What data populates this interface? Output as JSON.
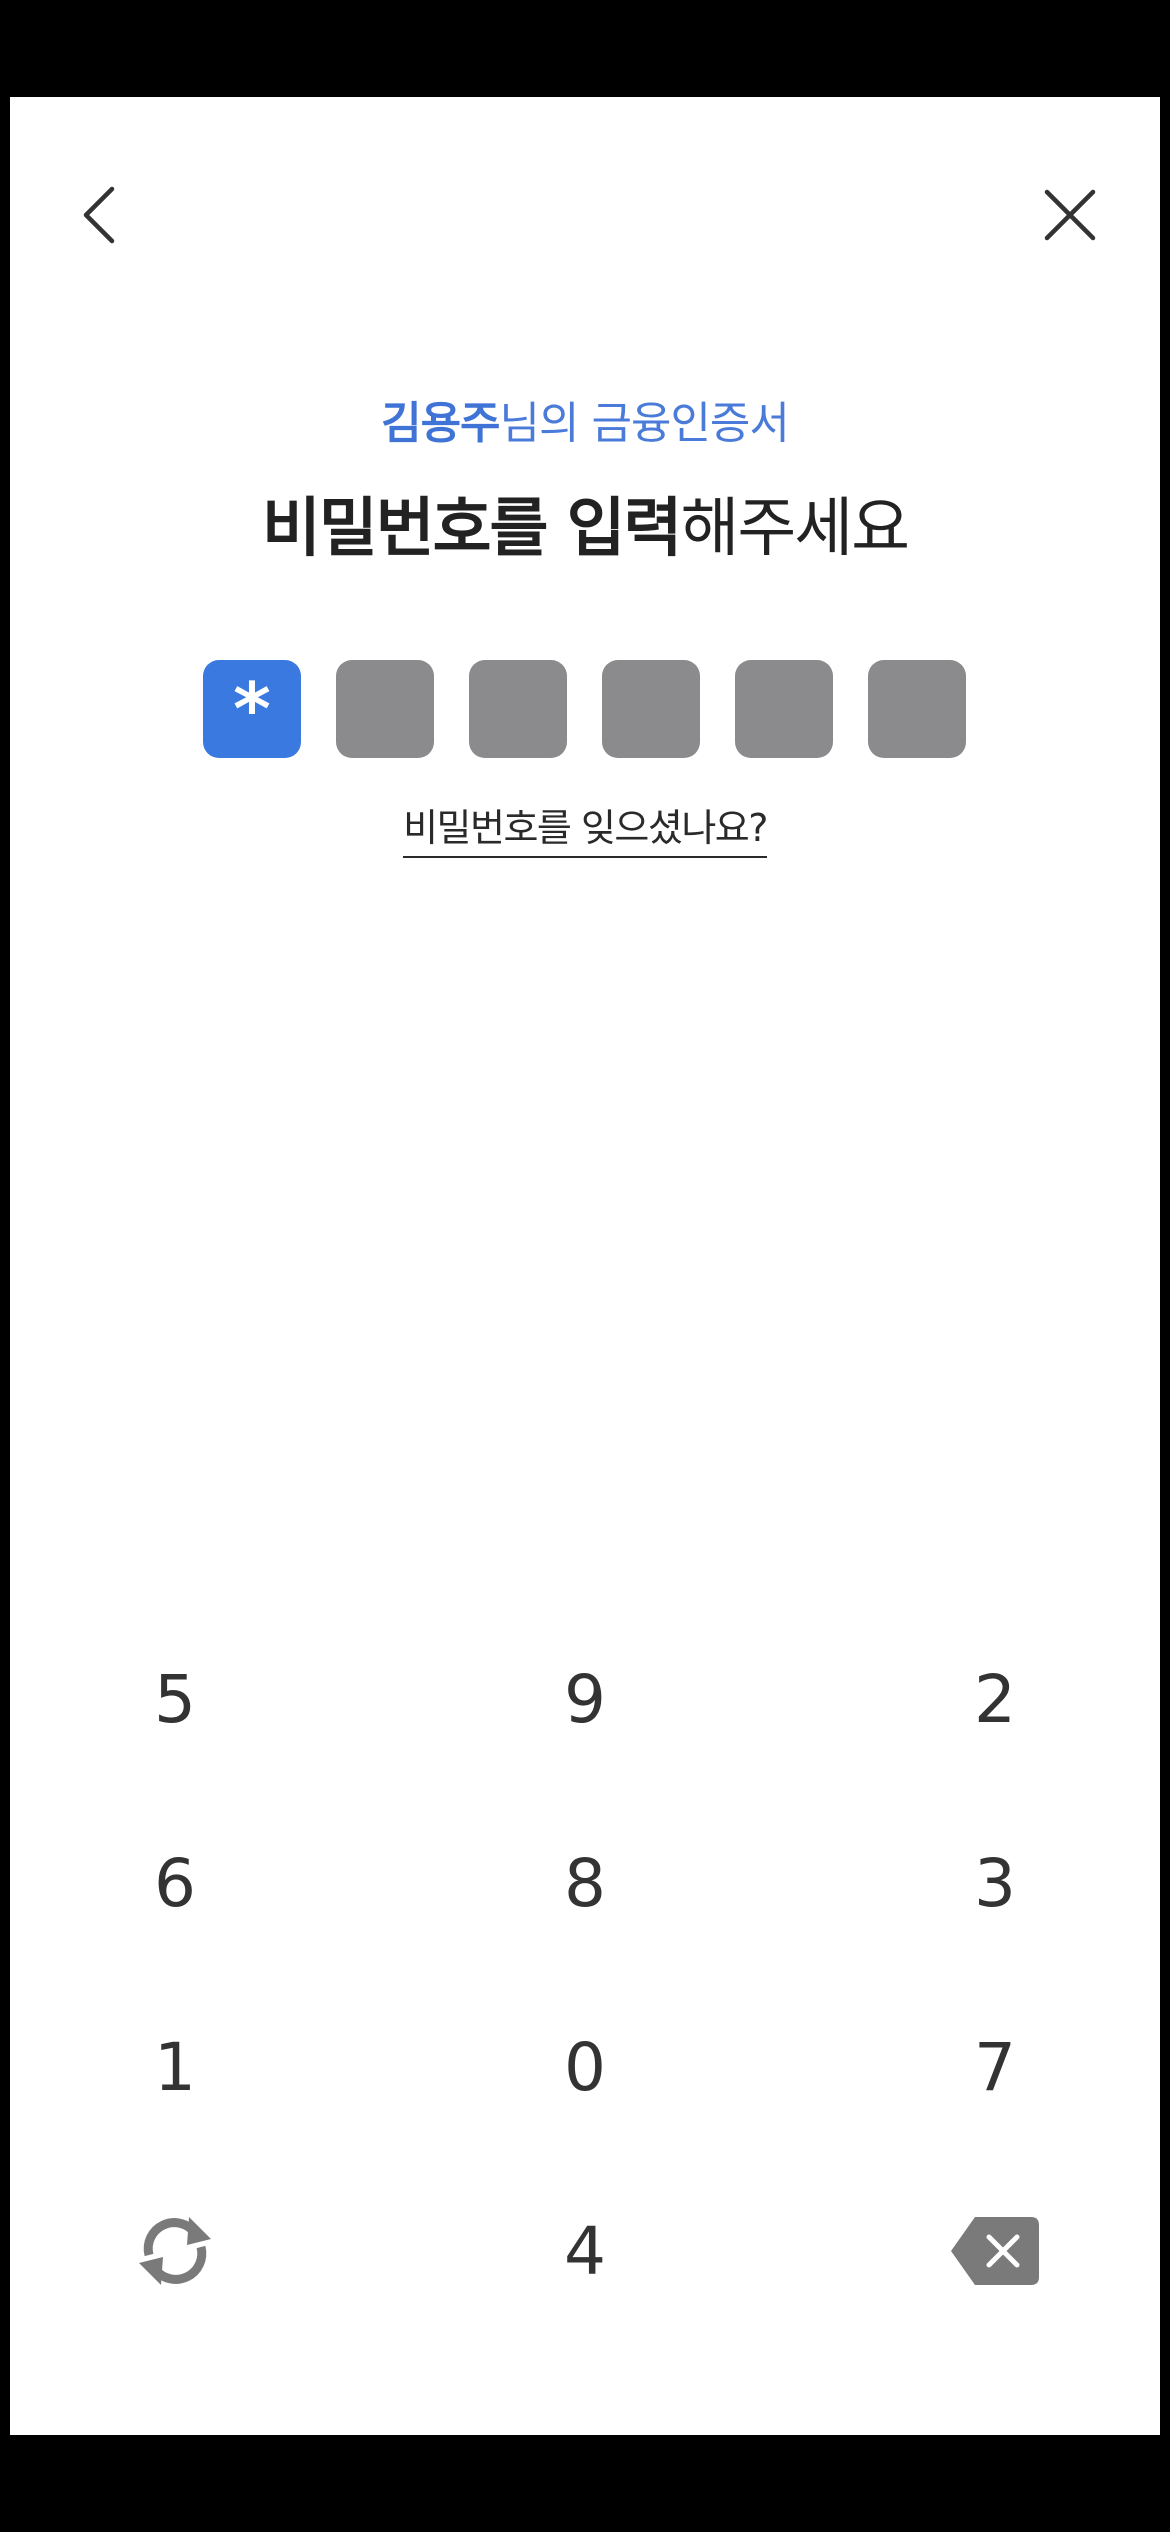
{
  "header": {
    "back_icon": "chevron-left-icon",
    "close_icon": "close-icon"
  },
  "subtitle": {
    "name": "김용주",
    "rest": "님의 금융인증서"
  },
  "title": {
    "bold1": "비밀번호를 입력",
    "rest": "해주세요"
  },
  "pin": {
    "boxes": [
      "*",
      "",
      "",
      "",
      "",
      ""
    ],
    "filled_color": "#3a7ae0",
    "empty_color": "#8b8b8e"
  },
  "forgot_link": "비밀번호를 잊으셨나요?",
  "keypad": {
    "rows": [
      [
        "5",
        "9",
        "2"
      ],
      [
        "6",
        "8",
        "3"
      ],
      [
        "1",
        "0",
        "7"
      ],
      [
        "",
        "4",
        ""
      ]
    ],
    "shuffle_icon": "refresh-icon",
    "backspace_icon": "backspace-icon"
  },
  "colors": {
    "accent": "#3f73d6",
    "background": "#ffffff"
  }
}
